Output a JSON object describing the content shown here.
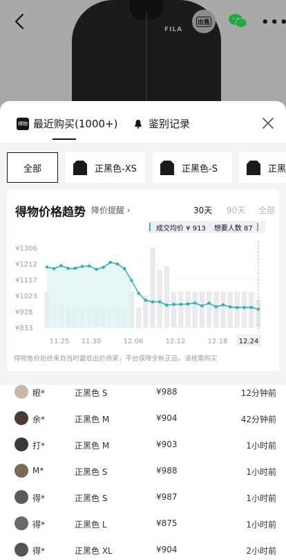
{
  "header": {
    "brand_text": "FILA",
    "sell_label": "出售"
  },
  "sheet": {
    "tabs": [
      {
        "label": "最近购买(1000+)",
        "logo": "得物"
      },
      {
        "label": "鉴别记录"
      }
    ],
    "filters": [
      {
        "label": "全部"
      },
      {
        "label": "正黑色-XS"
      },
      {
        "label": "正黑色-S"
      },
      {
        "label": "正黑"
      }
    ]
  },
  "trend": {
    "title": "得物价格趋势",
    "reminder_link": "降价提醒 ›",
    "periods": [
      "30天",
      "90天",
      "全部"
    ],
    "avg_label": "成交均价 ¥ 913",
    "want_label": "想要人数 87",
    "note": "得物售价始终来自当时最低出价商家，平台保障全新正品，请按需购买"
  },
  "chart_data": {
    "type": "line",
    "title": "",
    "xlabel": "",
    "ylabel": "",
    "y_ticks": [
      "¥1306",
      "¥1212",
      "¥1117",
      "¥1023",
      "¥928",
      "¥833"
    ],
    "x_ticks": [
      "11.25",
      "11.30",
      "12.06",
      "12.12",
      "12.18",
      "12.24"
    ],
    "ylim": [
      833,
      1306
    ],
    "highlighted_x_tick": "12.24",
    "series": [
      {
        "values": [
          1192,
          1182,
          1200,
          1184,
          1184,
          1196,
          1198,
          1178,
          1190,
          1220,
          1210,
          1182,
          1112,
          1036,
          994,
          985,
          985,
          965,
          970,
          970,
          972,
          978,
          961,
          977,
          956,
          967,
          955,
          951,
          951,
          952,
          942
        ]
      }
    ],
    "bars_relative": [
      0.45,
      0.27,
      0.27,
      0.25,
      0.25,
      0.25,
      0.25,
      0.25,
      0.25,
      0.25,
      0.25,
      0.25,
      0.45,
      0.25,
      0.4,
      1.0,
      0.72,
      0.77,
      0.45,
      0.45,
      0.45,
      0.45,
      0.45,
      0.45,
      0.45,
      0.45,
      0.45,
      0.45,
      0.45,
      0.45,
      0.35
    ],
    "grid": true
  },
  "trades": [
    {
      "user": "眼*",
      "sku": "正黑色 S",
      "price": "¥988",
      "time": "12分钟前",
      "avatar_color": "#c9b8a8"
    },
    {
      "user": "余*",
      "sku": "正黑色 M",
      "price": "¥904",
      "time": "42分钟前",
      "avatar_color": "#4a3a30"
    },
    {
      "user": "打*",
      "sku": "正黑色 M",
      "price": "¥903",
      "time": "1小时前",
      "avatar_color": "#3a3a3a"
    },
    {
      "user": "M*",
      "sku": "正黑色 S",
      "price": "¥988",
      "time": "1小时前",
      "avatar_color": "#7a6a50"
    },
    {
      "user": "得*",
      "sku": "正黑色 S",
      "price": "¥987",
      "time": "1小时前",
      "avatar_color": "#5a5a5a"
    },
    {
      "user": "得*",
      "sku": "正黑色 L",
      "price": "¥875",
      "time": "1小时前",
      "avatar_color": "#6a6a6a"
    },
    {
      "user": "得*",
      "sku": "正黑色 XL",
      "price": "¥904",
      "time": "2小时前",
      "avatar_color": "#555555"
    }
  ],
  "colors": {
    "accent": "#31b3b0",
    "text": "#14151a",
    "muted": "#9c9ca4"
  }
}
